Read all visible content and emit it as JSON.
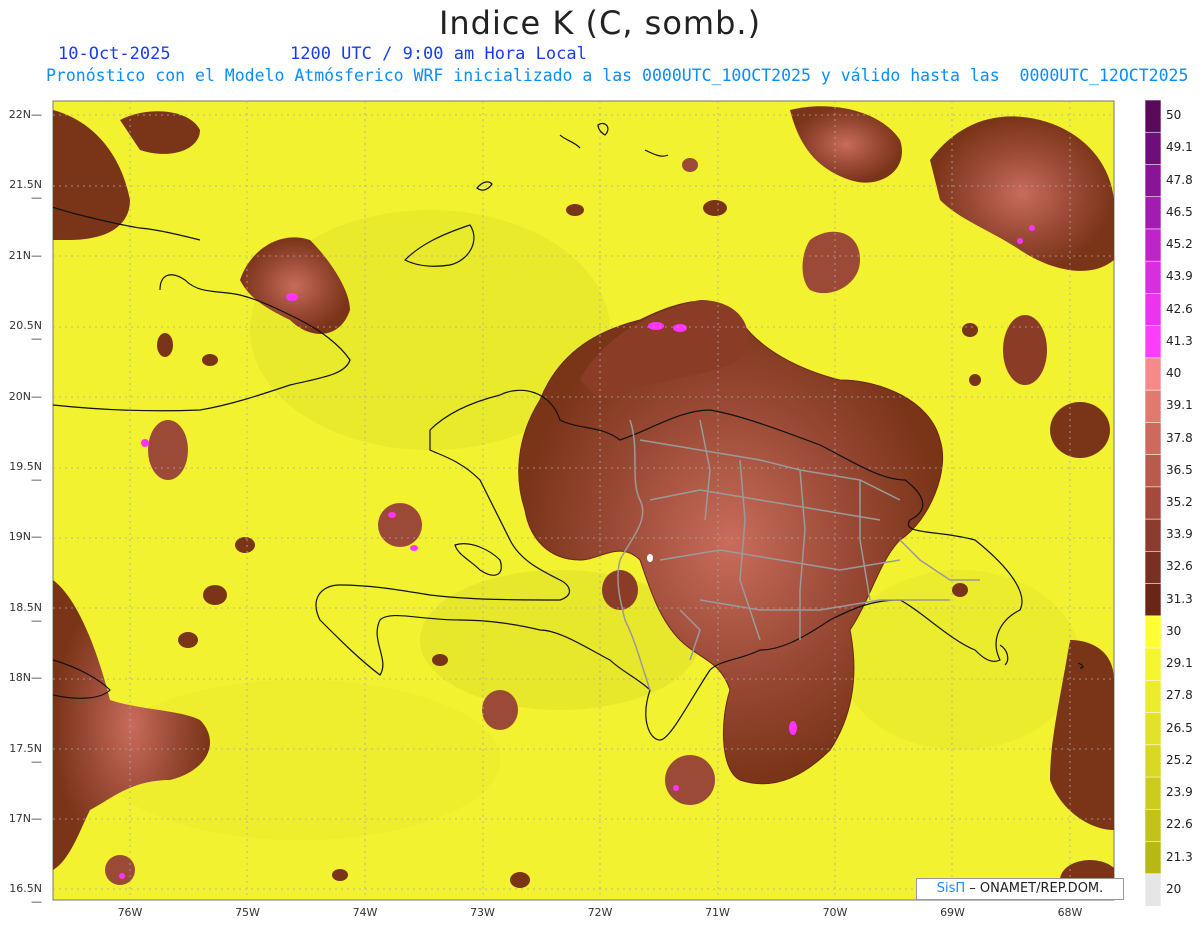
{
  "header": {
    "title": "Indice K (C, somb.)",
    "date": "10-Oct-2025",
    "valid_time": "1200 UTC / 9:00 am Hora Local",
    "subtitle": "Pronóstico con el Modelo Atmósferico WRF inicializado a las 0000UTC_10OCT2025 y válido hasta las  0000UTC_12OCT2025"
  },
  "map": {
    "lat_labels": [
      "22N",
      "21.5N",
      "21N",
      "20.5N",
      "20N",
      "19.5N",
      "19N",
      "18.5N",
      "18N",
      "17.5N",
      "17N",
      "16.5N"
    ],
    "lon_labels": [
      "76W",
      "75W",
      "74W",
      "73W",
      "72W",
      "71W",
      "70W",
      "69W",
      "68W"
    ],
    "lat_values": [
      22,
      21.5,
      21,
      20.5,
      20,
      19.5,
      19,
      18.5,
      18,
      17.5,
      17,
      16.5
    ],
    "lon_values": [
      -76,
      -75,
      -74,
      -73,
      -72,
      -71,
      -70,
      -69,
      -68
    ],
    "background_color": "#f2f230",
    "high_k_color": "#7a3418",
    "very_high_k_color": "#ff33ff"
  },
  "colorbar": {
    "labels": [
      "50",
      "49.1",
      "47.8",
      "46.5",
      "45.2",
      "43.9",
      "42.6",
      "41.3",
      "40",
      "39.1",
      "37.8",
      "36.5",
      "35.2",
      "33.9",
      "32.6",
      "31.3",
      "30",
      "29.1",
      "27.8",
      "26.5",
      "25.2",
      "23.9",
      "22.6",
      "21.3",
      "20"
    ],
    "colors": [
      "#5a0a5a",
      "#6e0e7a",
      "#8a1496",
      "#a31cb0",
      "#bf24c8",
      "#d92ee0",
      "#ee33f0",
      "#ff3dff",
      "#f58a8a",
      "#e07a70",
      "#cc6a5e",
      "#b85a4c",
      "#a44a3c",
      "#8c3c2c",
      "#7a3020",
      "#6a2614",
      "#ffff33",
      "#f5f530",
      "#ecec2c",
      "#e2e228",
      "#d8d822",
      "#cccc1c",
      "#c2c218",
      "#b8b814",
      "#e6e6e6"
    ]
  },
  "credit": {
    "brand": "SisΠ",
    "org": " – ONAMET/REP.DOM."
  }
}
